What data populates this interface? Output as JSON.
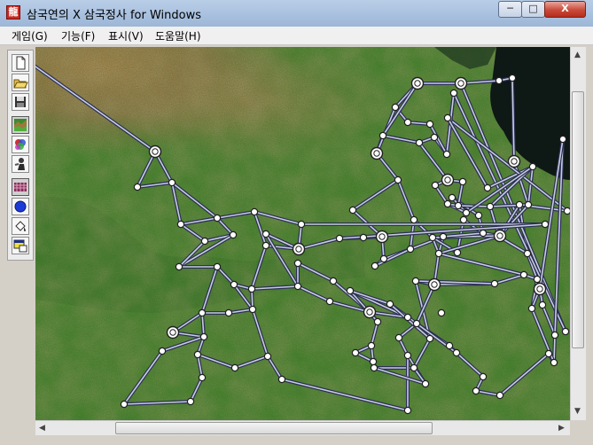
{
  "window": {
    "title": "삼국연의 X 삼국정사 for  Windows",
    "app_icon_glyph": "龍",
    "minimize_glyph": "─",
    "maximize_glyph": "□",
    "close_glyph": "X"
  },
  "menubar": {
    "items": [
      {
        "label": "게임(G)"
      },
      {
        "label": "기능(F)"
      },
      {
        "label": "표시(V)"
      },
      {
        "label": "도움말(H)"
      }
    ]
  },
  "toolbar": {
    "buttons": [
      {
        "icon": "new-document-icon"
      },
      {
        "icon": "open-folder-icon"
      },
      {
        "icon": "save-disk-icon"
      },
      {
        "icon": "terrain-map-icon"
      },
      {
        "icon": "color-palette-icon"
      },
      {
        "icon": "character-icon"
      },
      {
        "icon": "grid-pattern-icon"
      },
      {
        "icon": "blue-circle-icon"
      },
      {
        "icon": "paint-bucket-icon"
      },
      {
        "icon": "window-icon"
      }
    ]
  },
  "colors": {
    "road": "#c8cde0",
    "road_shadow": "#2b2f55",
    "node_fill": "#ffffff",
    "node_stroke": "#202020",
    "water": "#0e1814",
    "titlebar": "#a9c1df"
  }
}
